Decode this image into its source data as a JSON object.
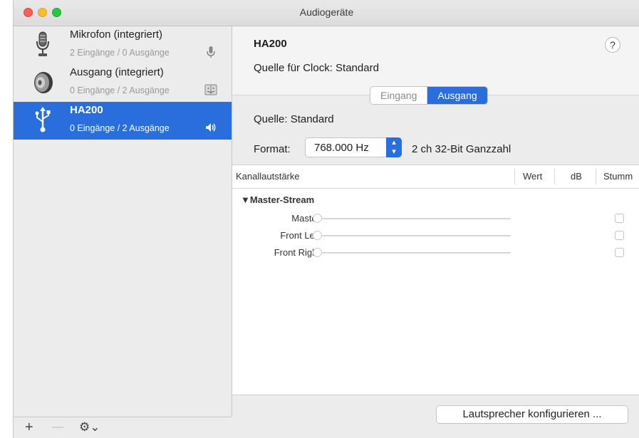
{
  "window": {
    "title": "Audiogeräte"
  },
  "sidebar": {
    "devices": [
      {
        "name": "Mikrofon (integriert)",
        "io": "2 Eingänge / 0 Ausgänge",
        "icon": "microphone-icon",
        "status_icon": "mic-small-icon"
      },
      {
        "name": "Ausgang (integriert)",
        "io": "0 Eingänge / 2 Ausgänge",
        "icon": "speaker-icon",
        "status_icon": "finder-icon"
      },
      {
        "name": "HA200",
        "io": "0 Eingänge / 2 Ausgänge",
        "icon": "usb-icon",
        "status_icon": "volume-icon",
        "selected": true
      }
    ],
    "bottom": {
      "add": "+",
      "remove": "—",
      "gear": "⚙︎⌄"
    }
  },
  "main": {
    "device_title": "HA200",
    "clock_label": "Quelle für Clock:",
    "clock_value": "Standard",
    "help": "?",
    "tabs": [
      {
        "label": "Eingang",
        "active": false
      },
      {
        "label": "Ausgang",
        "active": true
      }
    ],
    "source_label": "Quelle:",
    "source_value": "Standard",
    "format_label": "Format:",
    "format_value": "768.000 Hz",
    "format_desc": "2 ch 32-Bit Ganzzahl",
    "table": {
      "columns": [
        "Kanallautstärke",
        "Wert",
        "dB",
        "Stumm"
      ],
      "group": "▼Master-Stream",
      "rows": [
        {
          "label": "Master"
        },
        {
          "label": "Front Left"
        },
        {
          "label": "Front Right"
        }
      ]
    },
    "configure_button": "Lautsprecher konfigurieren ..."
  },
  "colors": {
    "accent": "#2a6ddc",
    "close": "#fe5f57",
    "minimize": "#febc2e",
    "maximize": "#28c840"
  }
}
